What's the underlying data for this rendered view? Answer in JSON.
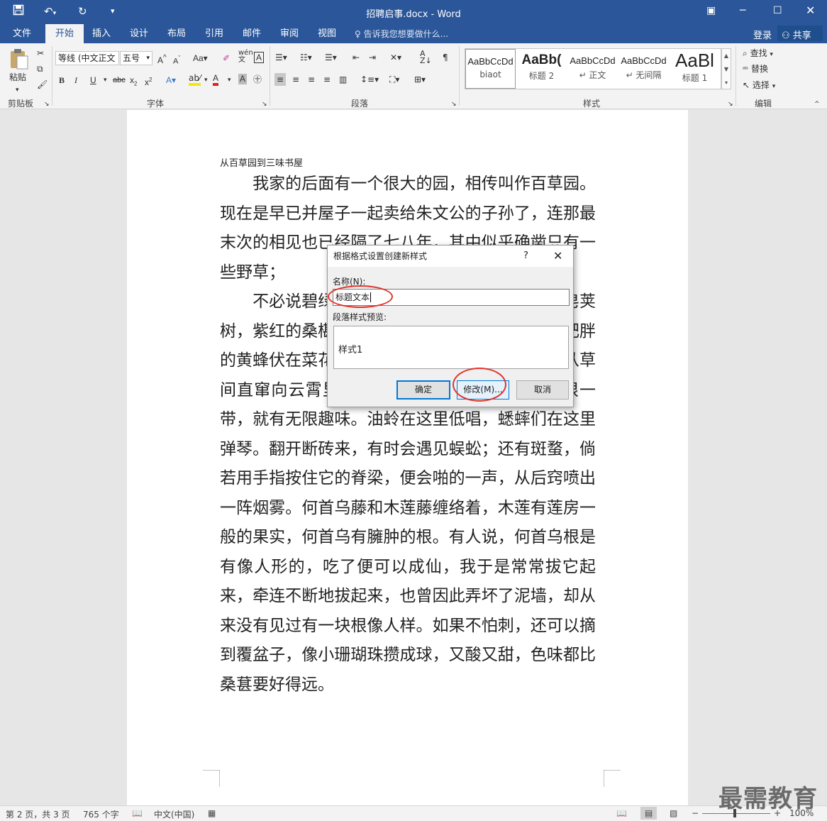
{
  "window": {
    "title": "招聘启事.docx - Word"
  },
  "tabs": [
    "文件",
    "开始",
    "插入",
    "设计",
    "布局",
    "引用",
    "邮件",
    "审阅",
    "视图"
  ],
  "active_tab": "开始",
  "tellme": "告诉我您想要做什么...",
  "account": {
    "login": "登录",
    "share": "共享"
  },
  "ribbon": {
    "groups": [
      "剪贴板",
      "字体",
      "段落",
      "样式",
      "编辑"
    ],
    "paste": "粘贴",
    "font_name": "等线 (中文正文",
    "font_size": "五号",
    "styles": [
      {
        "preview": "AaBbCcDd",
        "name": "biaot"
      },
      {
        "preview": "AaBb(",
        "name": "标题 2"
      },
      {
        "preview": "AaBbCcDd",
        "name": "↵ 正文"
      },
      {
        "preview": "AaBbCcDd",
        "name": "↵ 无间隔"
      },
      {
        "preview": "AaBl",
        "name": "标题 1"
      }
    ],
    "editing": [
      "查找",
      "替换",
      "选择"
    ]
  },
  "document": {
    "header": "从百草园到三味书屋",
    "paragraphs": [
      "　　我家的后面有一个很大的园，相传叫作百草园。现在是早已并屋子一起卖给朱文公的子孙了，连那最末次的相见也已经隔了七八年，其中似乎确凿只有一些野草；",
      "　　不必说碧绿的菜畦，光滑的石井栏，高大的皂荚树，紫红的桑椹；也不必说鸣蝉在树叶里长吟，肥胖的黄蜂伏在菜花上，轻捷的叫天子（云雀）忽然从草间直窜向云霄里去了。单是周围的短短的泥墙根一带，就有无限趣味。油蛉在这里低唱，蟋蟀们在这里弹琴。翻开断砖来，有时会遇见蜈蚣；还有斑蝥，倘若用手指按住它的脊梁，便会啪的一声，从后窍喷出一阵烟雾。何首乌藤和木莲藤缠络着，木莲有莲房一般的果实，何首乌有臃肿的根。有人说，何首乌根是有像人形的，吃了便可以成仙，我于是常常拔它起来，牵连不断地拔起来，也曾因此弄坏了泥墙，却从来没有见过有一块根像人样。如果不怕刺，还可以摘到覆盆子，像小珊瑚珠攒成球，又酸又甜，色味都比桑葚要好得远。"
    ]
  },
  "dialog": {
    "title": "根据格式设置创建新样式",
    "help": "?",
    "name_label": "名称(N):",
    "name_value": "标题文本",
    "preview_label": "段落样式预览:",
    "preview_text": "样式1",
    "ok": "确定",
    "modify": "修改(M)...",
    "cancel": "取消"
  },
  "status": {
    "page": "第 2 页，共 3 页",
    "words": "765 个字",
    "language": "中文(中国)",
    "zoom": "100%"
  },
  "watermark": "最需教育",
  "colors": {
    "accent": "#2b579a",
    "annotation": "#e0342c"
  }
}
